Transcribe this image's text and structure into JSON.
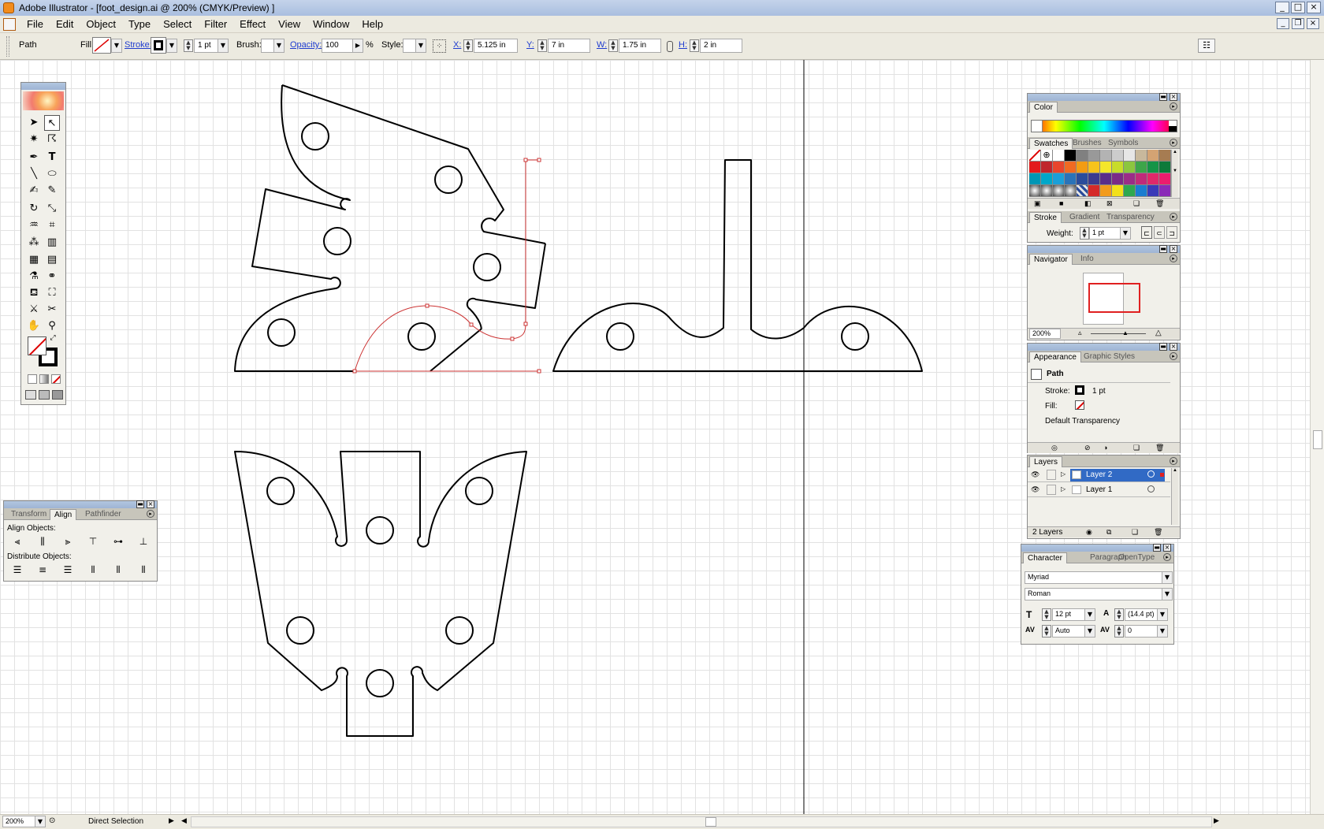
{
  "window": {
    "title": "Adobe Illustrator - [foot_design.ai @ 200% (CMYK/Preview) ]"
  },
  "menu": [
    "File",
    "Edit",
    "Object",
    "Type",
    "Select",
    "Filter",
    "Effect",
    "View",
    "Window",
    "Help"
  ],
  "control": {
    "selection": "Path",
    "fill_label": "Fill:",
    "stroke_label": "Stroke:",
    "stroke_weight": "1 pt",
    "brush_label": "Brush:",
    "opacity_label": "Opacity:",
    "opacity_value": "100",
    "percent": "%",
    "style_label": "Style:",
    "x_label": "X:",
    "x_value": "5.125 in",
    "y_label": "Y:",
    "y_value": "7 in",
    "w_label": "W:",
    "w_value": "1.75 in",
    "h_label": "H:",
    "h_value": "2 in"
  },
  "align_panel": {
    "tabs": [
      "Transform",
      "Align",
      "Pathfinder"
    ],
    "active_tab": "Align",
    "align_objects_label": "Align Objects:",
    "distribute_objects_label": "Distribute Objects:"
  },
  "color_panel": {
    "tab": "Color"
  },
  "swatches_panel": {
    "tabs": [
      "Swatches",
      "Brushes",
      "Symbols"
    ]
  },
  "stroke_panel": {
    "tabs": [
      "Stroke",
      "Gradient",
      "Transparency"
    ],
    "weight_label": "Weight:",
    "weight_value": "1 pt"
  },
  "navigator_panel": {
    "tabs": [
      "Navigator",
      "Info"
    ],
    "zoom": "200%"
  },
  "appearance_panel": {
    "tabs": [
      "Appearance",
      "Graphic Styles"
    ],
    "item": "Path",
    "stroke_label": "Stroke:",
    "stroke_value": "1 pt",
    "fill_label": "Fill:",
    "transparency": "Default Transparency"
  },
  "layers_panel": {
    "tab": "Layers",
    "layers": [
      {
        "name": "Layer 2",
        "selected": true
      },
      {
        "name": "Layer 1",
        "selected": false
      }
    ],
    "count": "2 Layers"
  },
  "character_panel": {
    "tabs": [
      "Character",
      "Paragraph",
      "OpenType"
    ],
    "font": "Myriad",
    "style": "Roman",
    "size": "12 pt",
    "leading": "(14.4 pt)",
    "kerning": "Auto",
    "tracking": "0"
  },
  "status": {
    "zoom": "200%",
    "tool": "Direct Selection"
  },
  "colors": {
    "selection": "#cc3333",
    "panel_title": "#a9bedf",
    "layer_selected": "#316ac5"
  }
}
